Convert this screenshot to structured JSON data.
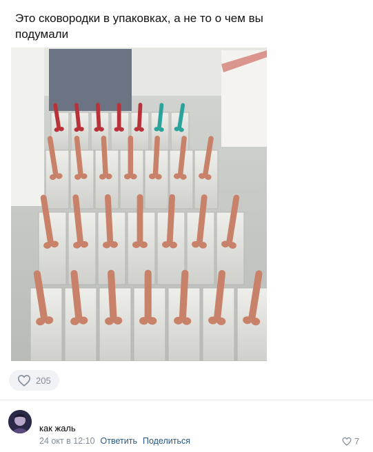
{
  "post": {
    "caption": "Это сковородки в упаковках, а не то о чем вы подумали",
    "likes": "205"
  },
  "comment": {
    "text": "как жаль",
    "time": "24 окт в 12:10",
    "reply": "Ответить",
    "share": "Поделиться",
    "likes": "7"
  },
  "icons": {
    "post_like": "heart-outline-icon",
    "comment_like": "heart-outline-icon"
  }
}
